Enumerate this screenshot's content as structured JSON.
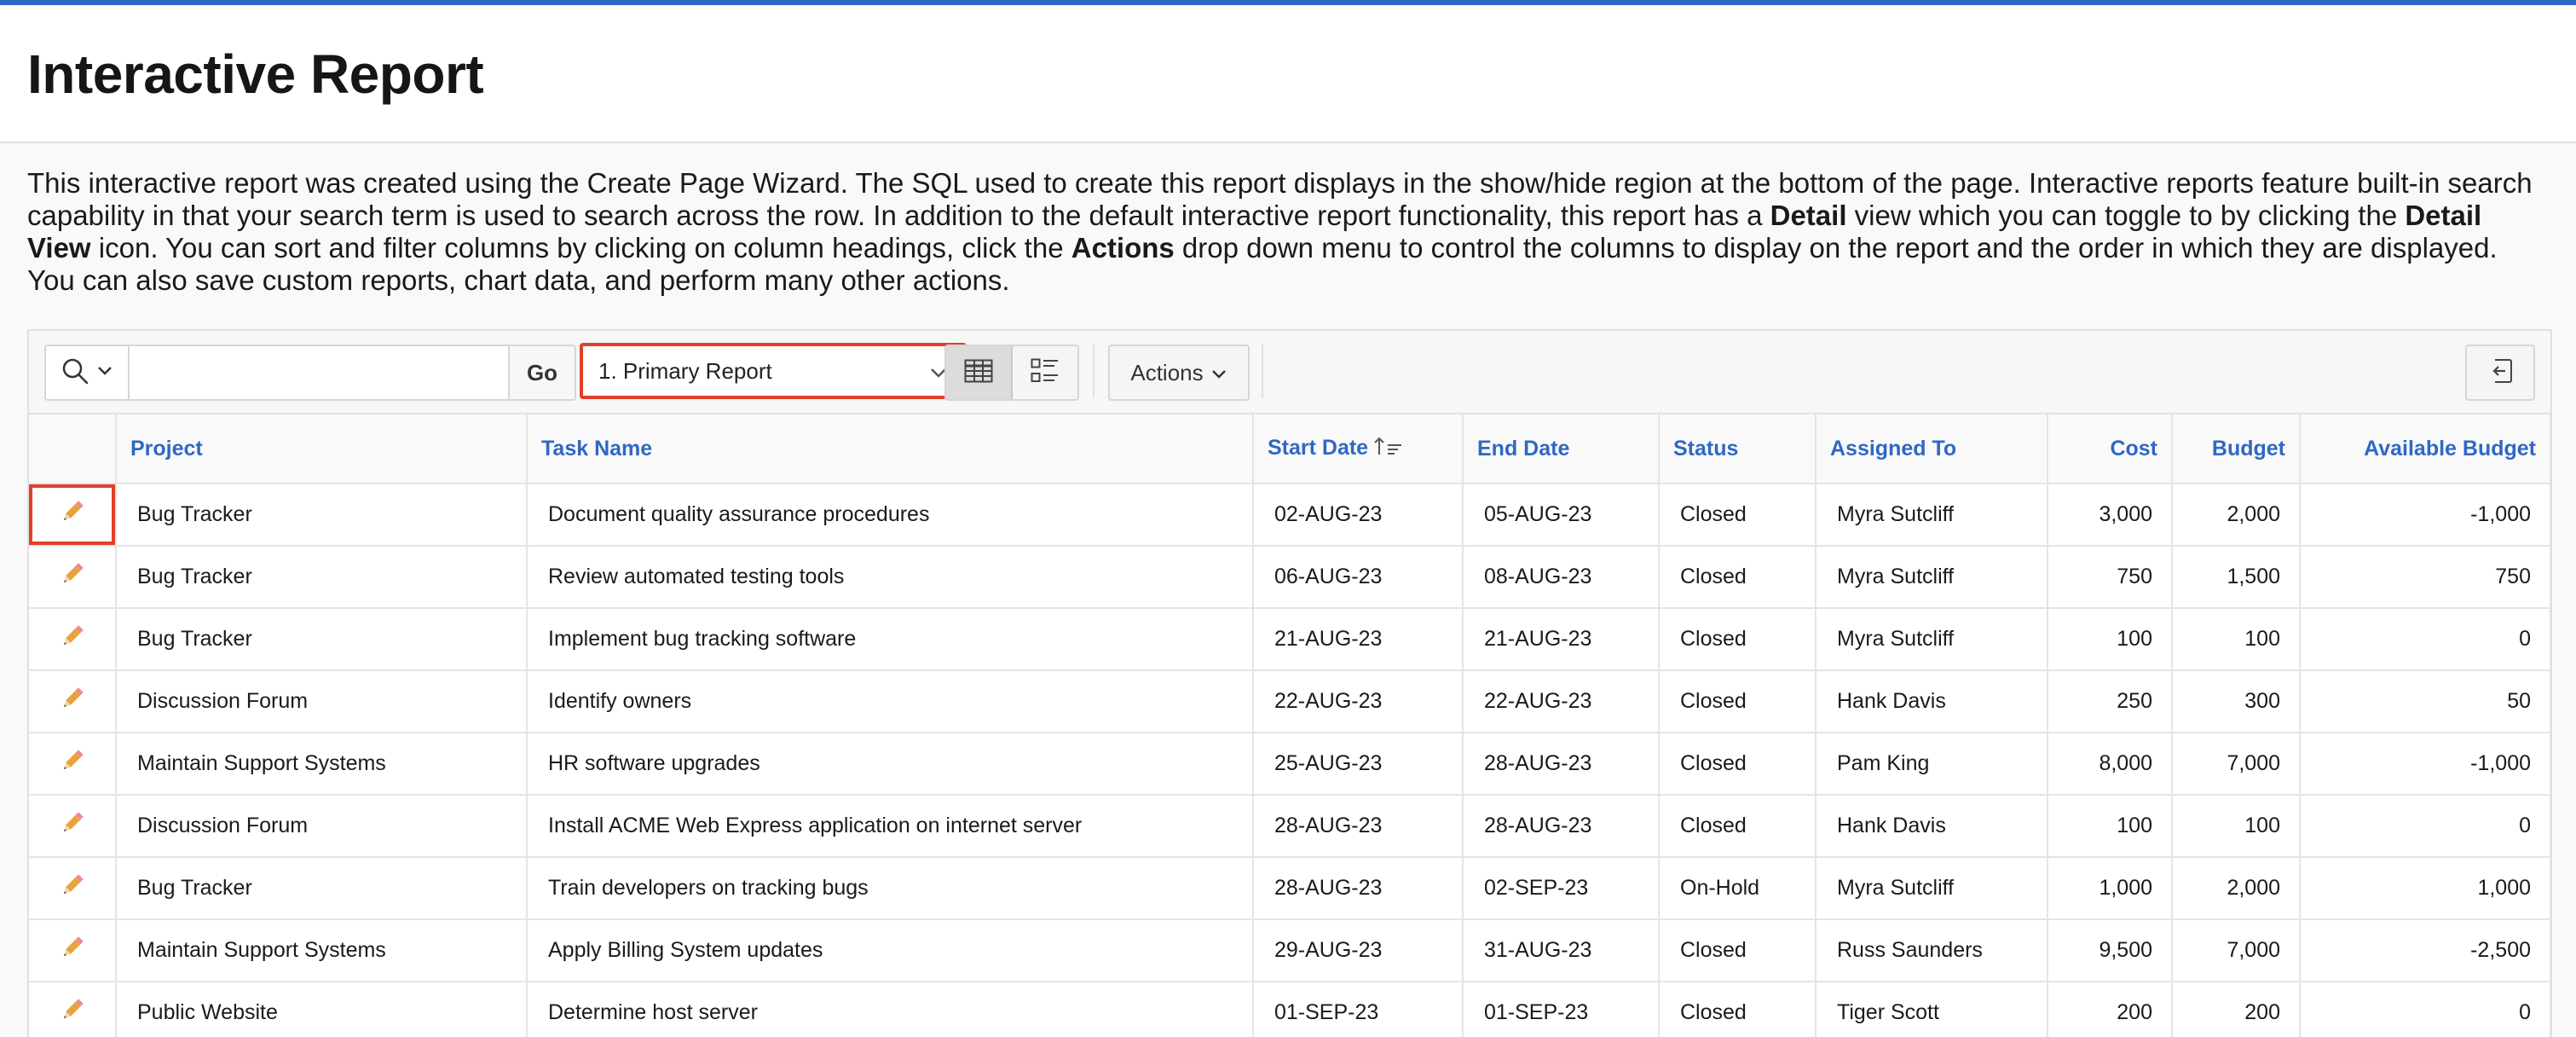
{
  "header": {
    "title": "Interactive Report"
  },
  "intro": {
    "p1": "This interactive report was created using the Create Page Wizard. The SQL used to create this report displays in the show/hide region at the bottom of the page. Interactive reports feature built-in search capability in that your search term is used to search across the row. In addition to the default interactive report functionality, this report has a ",
    "b1": "Detail",
    "p2": " view which you can toggle to by clicking the ",
    "b2": "Detail View",
    "p3": " icon. You can sort and filter columns by clicking on column headings, click the ",
    "b3": "Actions",
    "p4": " drop down menu to control the columns to display on the report and the order in which they are displayed. You can also save custom reports, chart data, and perform many other actions."
  },
  "toolbar": {
    "search_value": "",
    "search_placeholder": "",
    "go_label": "Go",
    "report_selected": "1. Primary Report",
    "actions_label": "Actions"
  },
  "icons": {
    "search": "search-icon",
    "chevron": "chevron-down-icon",
    "grid_view": "grid-view-icon",
    "detail_view": "detail-view-icon",
    "reset": "reset-icon",
    "edit": "pencil-icon",
    "sort": "sort-ascending-icon"
  },
  "colors": {
    "accent": "#2f68c4",
    "highlight": "#e0402a",
    "pencil": "#e8a33d"
  },
  "table": {
    "columns": [
      "",
      "Project",
      "Task Name",
      "Start Date",
      "End Date",
      "Status",
      "Assigned To",
      "Cost",
      "Budget",
      "Available Budget"
    ],
    "rows": [
      [
        "Bug Tracker",
        "Document quality assurance procedures",
        "02-AUG-23",
        "05-AUG-23",
        "Closed",
        "Myra Sutcliff",
        "3,000",
        "2,000",
        "-1,000"
      ],
      [
        "Bug Tracker",
        "Review automated testing tools",
        "06-AUG-23",
        "08-AUG-23",
        "Closed",
        "Myra Sutcliff",
        "750",
        "1,500",
        "750"
      ],
      [
        "Bug Tracker",
        "Implement bug tracking software",
        "21-AUG-23",
        "21-AUG-23",
        "Closed",
        "Myra Sutcliff",
        "100",
        "100",
        "0"
      ],
      [
        "Discussion Forum",
        "Identify owners",
        "22-AUG-23",
        "22-AUG-23",
        "Closed",
        "Hank Davis",
        "250",
        "300",
        "50"
      ],
      [
        "Maintain Support Systems",
        "HR software upgrades",
        "25-AUG-23",
        "28-AUG-23",
        "Closed",
        "Pam King",
        "8,000",
        "7,000",
        "-1,000"
      ],
      [
        "Discussion Forum",
        "Install ACME Web Express application on internet server",
        "28-AUG-23",
        "28-AUG-23",
        "Closed",
        "Hank Davis",
        "100",
        "100",
        "0"
      ],
      [
        "Bug Tracker",
        "Train developers on tracking bugs",
        "28-AUG-23",
        "02-SEP-23",
        "On-Hold",
        "Myra Sutcliff",
        "1,000",
        "2,000",
        "1,000"
      ],
      [
        "Maintain Support Systems",
        "Apply Billing System updates",
        "29-AUG-23",
        "31-AUG-23",
        "Closed",
        "Russ Saunders",
        "9,500",
        "7,000",
        "-2,500"
      ],
      [
        "Public Website",
        "Determine host server",
        "01-SEP-23",
        "01-SEP-23",
        "Closed",
        "Tiger Scott",
        "200",
        "200",
        "0"
      ]
    ]
  }
}
